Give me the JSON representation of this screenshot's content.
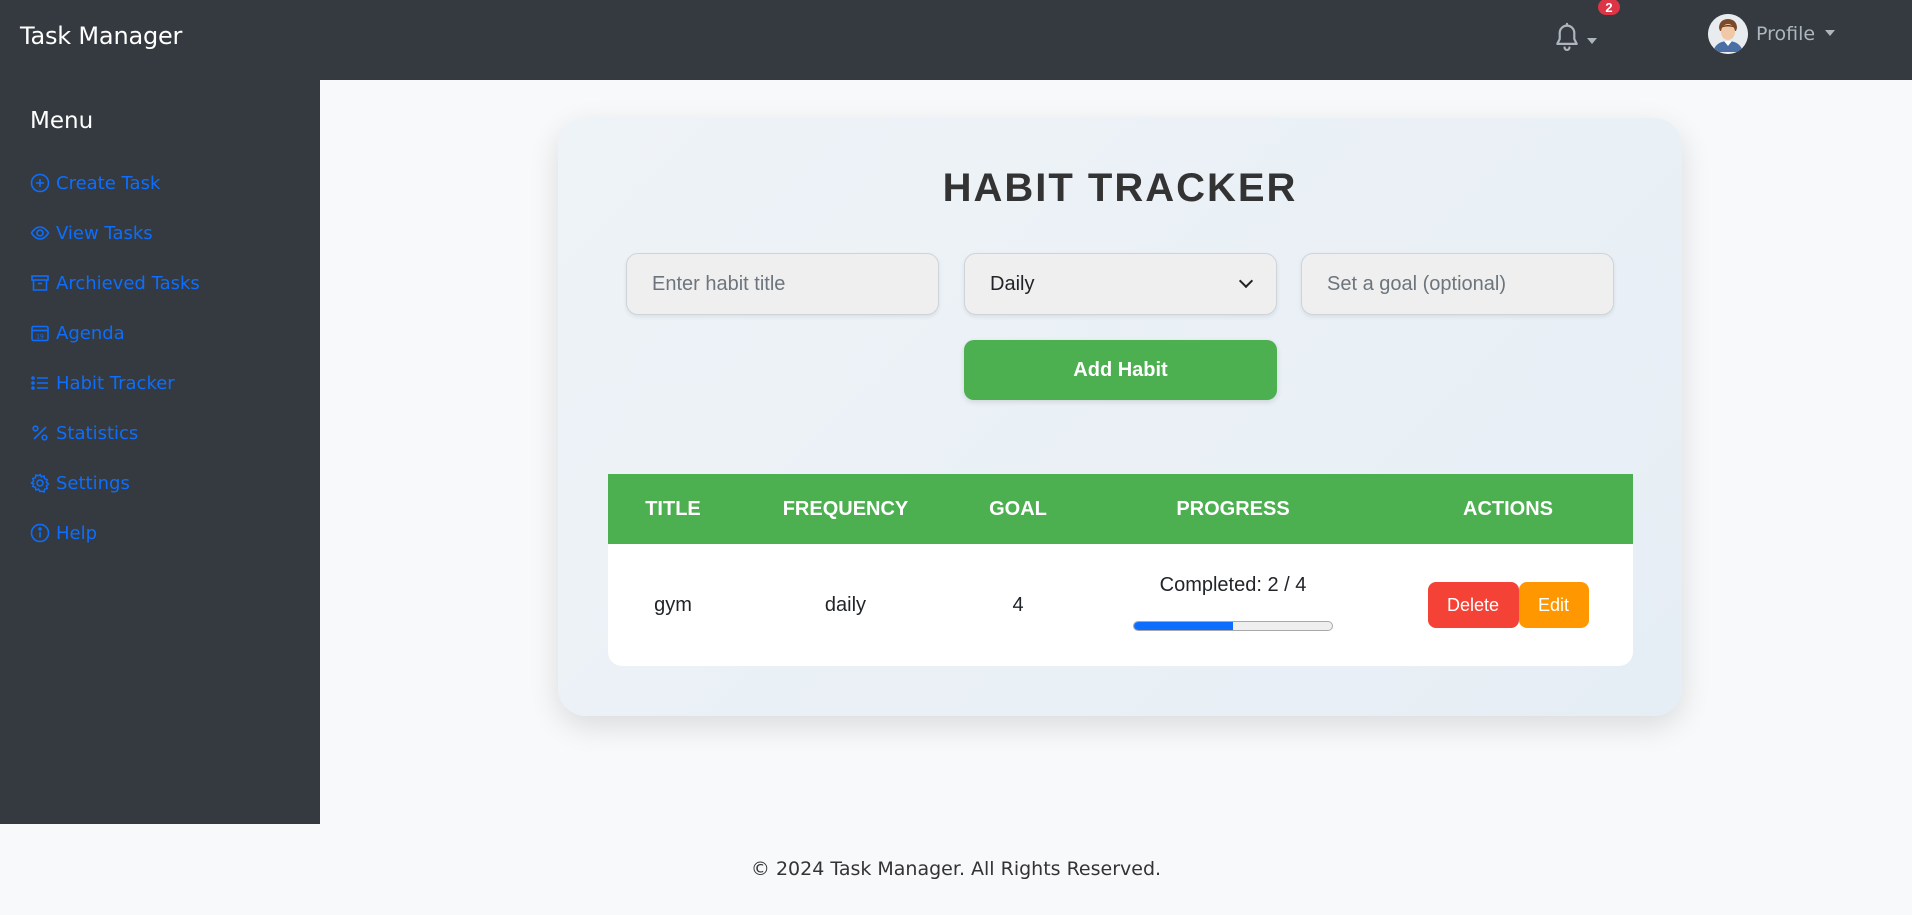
{
  "app": {
    "brand": "Task Manager"
  },
  "header": {
    "notifications": {
      "count": "2"
    },
    "profile": {
      "label": "Profile"
    }
  },
  "sidebar": {
    "title": "Menu",
    "items": [
      {
        "label": "Create Task",
        "icon": "plus-circle-icon"
      },
      {
        "label": "View Tasks",
        "icon": "eye-icon"
      },
      {
        "label": "Archieved Tasks",
        "icon": "archive-icon"
      },
      {
        "label": "Agenda",
        "icon": "calendar-icon"
      },
      {
        "label": "Habit Tracker",
        "icon": "list-icon"
      },
      {
        "label": "Statistics",
        "icon": "percent-icon"
      },
      {
        "label": "Settings",
        "icon": "gear-icon"
      },
      {
        "label": "Help",
        "icon": "info-circle-icon"
      }
    ]
  },
  "main": {
    "title": "HABIT TRACKER",
    "form": {
      "title_placeholder": "Enter habit title",
      "title_value": "",
      "frequency_value": "Daily",
      "goal_placeholder": "Set a goal (optional)",
      "goal_value": "",
      "add_label": "Add Habit"
    },
    "table": {
      "headers": [
        "TITLE",
        "FREQUENCY",
        "GOAL",
        "PROGRESS",
        "ACTIONS"
      ],
      "rows": [
        {
          "title": "gym",
          "frequency": "daily",
          "goal": "4",
          "progress_text": "Completed: 2 / 4",
          "progress_fraction": 0.5,
          "delete_label": "Delete",
          "edit_label": "Edit"
        }
      ]
    }
  },
  "footer": {
    "text": "© 2024 Task Manager. All Rights Reserved."
  },
  "colors": {
    "navbar": "#343a40",
    "link": "#0d6efd",
    "primary_green": "#4caf50",
    "delete_red": "#f44336",
    "edit_orange": "#ff9800",
    "badge_red": "#dc3545"
  }
}
